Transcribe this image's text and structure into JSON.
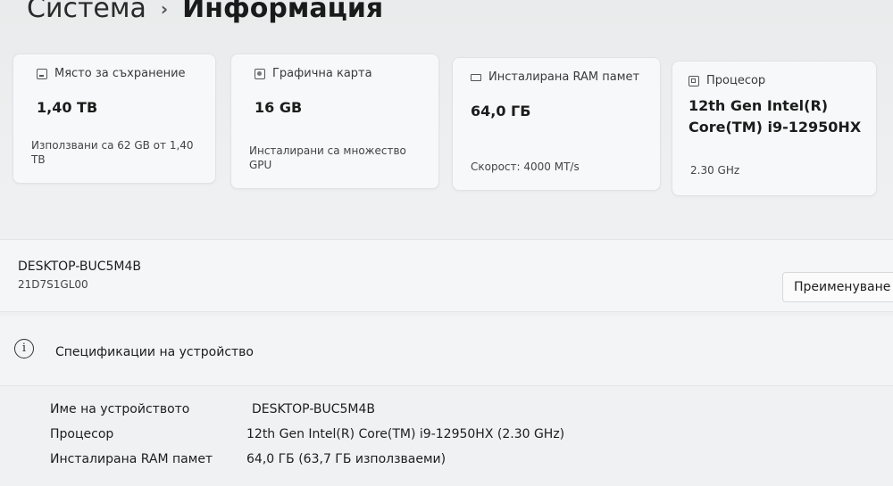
{
  "breadcrumb": {
    "parent": "Система",
    "separator": "›",
    "current": "Информация"
  },
  "cards": {
    "storage": {
      "title": "Място за съхранение",
      "value": "1,40 TB",
      "sub": "Използвани са 62 GB от 1,40 TB"
    },
    "gpu": {
      "title": "Графична карта",
      "value": "16 GB",
      "sub": "Инсталирани са множество GPU"
    },
    "ram": {
      "title": "Инсталирана RAM памет",
      "value": "64,0 ГБ",
      "sub": "Скорост: 4000 MT/s"
    },
    "cpu": {
      "title": "Процесор",
      "value": "12th Gen Intel(R) Core(TM) i9-12950HX",
      "sub": "2.30 GHz"
    }
  },
  "device": {
    "name": "DESKTOP-BUC5M4B",
    "model": "21D7S1GL00",
    "rename_label": "Преименуване"
  },
  "specifications": {
    "title": "Спецификации на устройство",
    "rows": [
      {
        "label": "Име на устройството",
        "value": "DESKTOP-BUC5M4B"
      },
      {
        "label": "Процесор",
        "value": "12th Gen Intel(R) Core(TM) i9-12950HX (2.30 GHz)"
      },
      {
        "label": "Инсталирана RAM памет",
        "value": "64,0 ГБ (63,7 ГБ използваеми)"
      }
    ]
  },
  "icons": {
    "storage": "storage-icon",
    "gpu": "gpu-icon",
    "ram": "ram-icon",
    "cpu": "processor-icon",
    "info": "info-icon"
  }
}
